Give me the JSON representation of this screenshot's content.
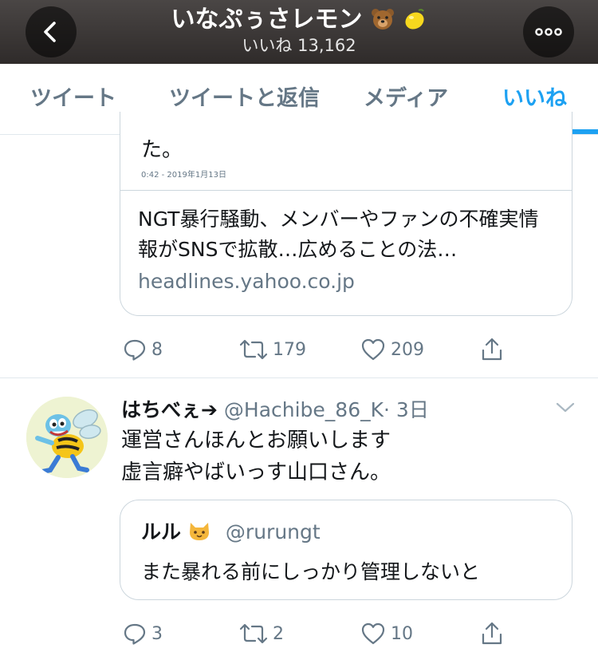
{
  "header": {
    "title": "いなぷぅさレモン",
    "title_emoji": [
      "bear-face-emoji",
      "lemon-emoji"
    ],
    "subtitle": "いいね 13,162",
    "back_icon": "chevron-left-icon",
    "more_icon": "more-horizontal-icon",
    "background": "#3b3736"
  },
  "tabs": [
    {
      "label": "ツイート",
      "active": false
    },
    {
      "label": "ツイートと返信",
      "active": false
    },
    {
      "label": "メディア",
      "active": false
    },
    {
      "label": "いいね",
      "active": true
    }
  ],
  "colors": {
    "accent": "#1da1f2",
    "secondary_text": "#657786",
    "border": "#ccd6dd"
  },
  "tweet1": {
    "clipped_text": "た。",
    "embedded_timestamp": "0:42 - 2019年1月13日",
    "link_card": {
      "title": "NGT暴行騒動、メンバーやファンの不確実情報がSNSで拡散…広めることの法…",
      "domain": "headlines.yahoo.co.jp"
    },
    "actions": {
      "replies": "8",
      "retweets": "179",
      "likes": "209"
    }
  },
  "tweet2": {
    "name": "はちべぇ➔",
    "handle": "@Hachibe_86_K",
    "time": "· 3日",
    "text_line1": "運営さんほんとお願いします",
    "text_line2": "虚言癖やばいっす山口さん。",
    "quote": {
      "name": "ルル",
      "name_emoji": "cat-face-emoji",
      "handle": "@rurungt",
      "text": "また暴れる前にしっかり管理しないと"
    },
    "actions": {
      "replies": "3",
      "retweets": "2",
      "likes": "10"
    }
  }
}
